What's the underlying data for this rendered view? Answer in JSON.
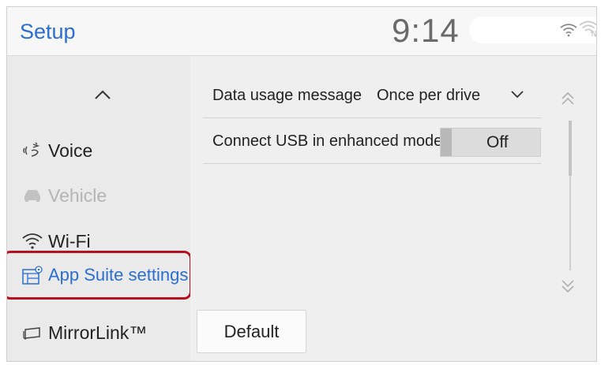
{
  "header": {
    "title": "Setup",
    "time": "9:14",
    "icons": [
      "wifi-icon",
      "wifi-hotspot-icon"
    ]
  },
  "sidebar": {
    "scroll_up_icon": "chevron-up-icon",
    "items": [
      {
        "label": "Voice",
        "icon": "voice-icon",
        "state": "normal"
      },
      {
        "label": "Vehicle",
        "icon": "car-icon",
        "state": "disabled"
      },
      {
        "label": "Wi-Fi",
        "icon": "wifi-icon",
        "state": "normal"
      },
      {
        "label": "App Suite settings",
        "icon": "app-settings-icon",
        "state": "active"
      },
      {
        "label": "MirrorLink™",
        "icon": "mirrorlink-icon",
        "state": "normal"
      }
    ]
  },
  "settings": {
    "rows": [
      {
        "label": "Data usage message",
        "value": "Once per drive",
        "control": "dropdown"
      },
      {
        "label": "Connect USB in enhanced mode",
        "value": "Off",
        "control": "toggle"
      }
    ],
    "default_button": "Default"
  },
  "colors": {
    "accent": "#2b6ed2",
    "highlight": "#b8101e",
    "background": "#ededed"
  }
}
